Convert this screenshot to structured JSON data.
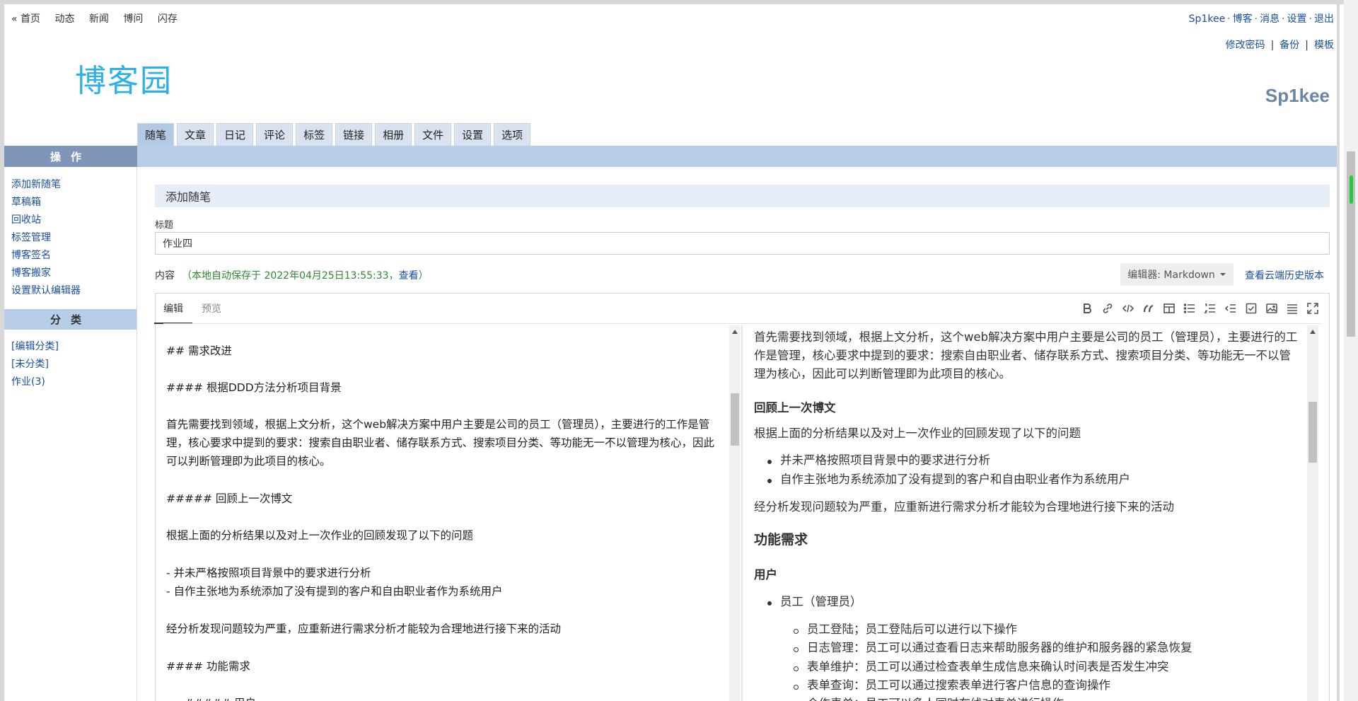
{
  "topnav": {
    "items": [
      "« 首页",
      "动态",
      "新闻",
      "博问",
      "闪存"
    ]
  },
  "user_links": {
    "user": "Sp1kee",
    "blog": "博客",
    "messages": "消息",
    "settings": "设置",
    "logout": "退出",
    "sep": "·"
  },
  "account_links": {
    "change_password": "修改密码",
    "backup": "备份",
    "template": "模板",
    "sep": "|"
  },
  "logo": {
    "text": "博客园"
  },
  "blog_name": "Sp1kee",
  "tabs": [
    "随笔",
    "文章",
    "日记",
    "评论",
    "标签",
    "链接",
    "相册",
    "文件",
    "设置",
    "选项"
  ],
  "sidebar": {
    "ops_title": "操作",
    "ops_items": [
      "添加新随笔",
      "草稿箱",
      "回收站",
      "标签管理",
      "博客签名",
      "博客搬家",
      "设置默认编辑器"
    ],
    "cat_title": "分类",
    "cat_items": [
      "[编辑分类]",
      "[未分类]",
      "作业(3)"
    ]
  },
  "main": {
    "section_title": "添加随笔",
    "title_label": "标题",
    "title_value": "作业四",
    "content_label": "内容",
    "autosave_prefix": "（本地自动保存于 2022年04月25日13:55:33，",
    "autosave_link": "查看",
    "autosave_suffix": "）",
    "editor_select": "编辑器: Markdown",
    "cloud_history": "查看云端历史版本"
  },
  "editor": {
    "tabs": {
      "edit": "编辑",
      "preview": "预览"
    },
    "toolbar_icons": [
      "bold-icon",
      "link-icon",
      "code-icon",
      "quote-icon",
      "table-icon",
      "unordered-list-icon",
      "ordered-list-icon",
      "outdent-icon",
      "task-list-icon",
      "image-icon",
      "align-icon",
      "fullscreen-icon"
    ],
    "markdown": {
      "l1": "## 需求改进",
      "l2": "#### 根据DDD方法分析项目背景",
      "p1": "首先需要找到领域，根据上文分析，这个web解决方案中用户主要是公司的员工（管理员），主要进行的工作是管理，核心要求中提到的要求：搜索自由职业者、储存联系方式、搜索项目分类、等功能无一不以管理为核心，因此可以判断管理即为此项目的核心。",
      "l3": "##### 回顾上一次博文",
      "l4": "根据上面的分析结果以及对上一次作业的回顾发现了以下的问题",
      "l5": "- 并未严格按照项目背景中的要求进行分析",
      "l6": "- 自作主张地为系统添加了没有提到的客户和自由职业者作为系统用户",
      "l7": "经分析发现问题较为严重，应重新进行需求分析才能较为合理地进行接下来的活动",
      "l8": "#### 功能需求",
      "l9": "##### 用户"
    },
    "preview": {
      "p1": "首先需要找到领域，根据上文分析，这个web解决方案中用户主要是公司的员工（管理员），主要进行的工作是管理，核心要求中提到的要求：搜索自由职业者、储存联系方式、搜索项目分类、等功能无一不以管理为核心，因此可以判断管理即为此项目的核心。",
      "h_review": "回顾上一次博文",
      "review_text": "根据上面的分析结果以及对上一次作业的回顾发现了以下的问题",
      "b1": "并未严格按照项目背景中的要求进行分析",
      "b2": "自作主张地为系统添加了没有提到的客户和自由职业者作为系统用户",
      "conclusion": "经分析发现问题较为严重，应重新进行需求分析才能较为合理地进行接下来的活动",
      "h_func": "功能需求",
      "h_user": "用户",
      "employee": "员工（管理员）",
      "s1": "员工登陆；员工登陆后可以进行以下操作",
      "s2": "日志管理：员工可以通过查看日志来帮助服务器的维护和服务器的紧急恢复",
      "s3": "表单维护：员工可以通过检查表单生成信息来确认时间表是否发生冲突",
      "s4": "表单查询：员工可以通过搜索表单进行客户信息的查询操作",
      "s5": "合作表单：员工可以多人同时在线对表单进行操作"
    }
  }
}
